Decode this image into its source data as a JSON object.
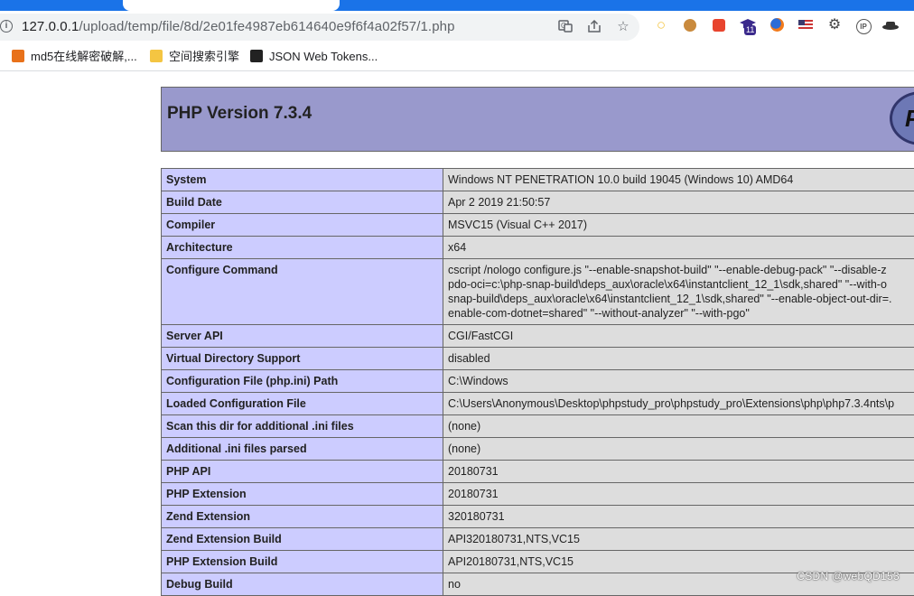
{
  "browser": {
    "url_host": "127.0.0.1",
    "url_path": "/upload/temp/file/8d/2e01fe4987eb614640e9f6f4a02f57/1.php",
    "extension_badge": "11",
    "bookmarks": [
      {
        "label": "md5在线解密破解,...",
        "icon_color": "#e8711a"
      },
      {
        "label": "空间搜索引擎",
        "icon_color": "#f4c542"
      },
      {
        "label": "JSON Web Tokens...",
        "icon_color": "#222222"
      }
    ]
  },
  "phpinfo": {
    "title": "PHP Version 7.3.4",
    "rows": [
      {
        "key": "System",
        "value": [
          "Windows NT PENETRATION 10.0 build 19045 (Windows 10) AMD64"
        ]
      },
      {
        "key": "Build Date",
        "value": [
          "Apr 2 2019 21:50:57"
        ]
      },
      {
        "key": "Compiler",
        "value": [
          "MSVC15 (Visual C++ 2017)"
        ]
      },
      {
        "key": "Architecture",
        "value": [
          "x64"
        ]
      },
      {
        "key": "Configure Command",
        "value": [
          "cscript /nologo configure.js \"--enable-snapshot-build\" \"--enable-debug-pack\" \"--disable-z",
          "pdo-oci=c:\\php-snap-build\\deps_aux\\oracle\\x64\\instantclient_12_1\\sdk,shared\" \"--with-o",
          "snap-build\\deps_aux\\oracle\\x64\\instantclient_12_1\\sdk,shared\" \"--enable-object-out-dir=.",
          "enable-com-dotnet=shared\" \"--without-analyzer\" \"--with-pgo\""
        ]
      },
      {
        "key": "Server API",
        "value": [
          "CGI/FastCGI"
        ]
      },
      {
        "key": "Virtual Directory Support",
        "value": [
          "disabled"
        ]
      },
      {
        "key": "Configuration File (php.ini) Path",
        "value": [
          "C:\\Windows"
        ]
      },
      {
        "key": "Loaded Configuration File",
        "value": [
          "C:\\Users\\Anonymous\\Desktop\\phpstudy_pro\\phpstudy_pro\\Extensions\\php\\php7.3.4nts\\p"
        ]
      },
      {
        "key": "Scan this dir for additional .ini files",
        "value": [
          "(none)"
        ]
      },
      {
        "key": "Additional .ini files parsed",
        "value": [
          "(none)"
        ]
      },
      {
        "key": "PHP API",
        "value": [
          "20180731"
        ]
      },
      {
        "key": "PHP Extension",
        "value": [
          "20180731"
        ]
      },
      {
        "key": "Zend Extension",
        "value": [
          "320180731"
        ]
      },
      {
        "key": "Zend Extension Build",
        "value": [
          "API320180731,NTS,VC15"
        ]
      },
      {
        "key": "PHP Extension Build",
        "value": [
          "API20180731,NTS,VC15"
        ]
      },
      {
        "key": "Debug Build",
        "value": [
          "no"
        ]
      }
    ]
  },
  "watermark": "CSDN @webQD153"
}
